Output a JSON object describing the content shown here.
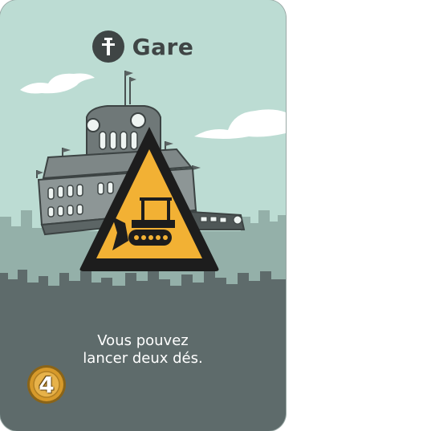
{
  "card": {
    "title": "Gare",
    "title_icon": "train-station-icon",
    "description_line1": "Vous pouvez",
    "description_line2": "lancer deux dés.",
    "cost": "4",
    "warning_icon": "bulldozer-warning-icon",
    "colors": {
      "sky": "#bcdcd3",
      "city_back": "#94b0a9",
      "city_front": "#5e6b6b",
      "title": "#3f4545",
      "warning_fill": "#f2b134",
      "coin": "#d79a2b"
    }
  }
}
